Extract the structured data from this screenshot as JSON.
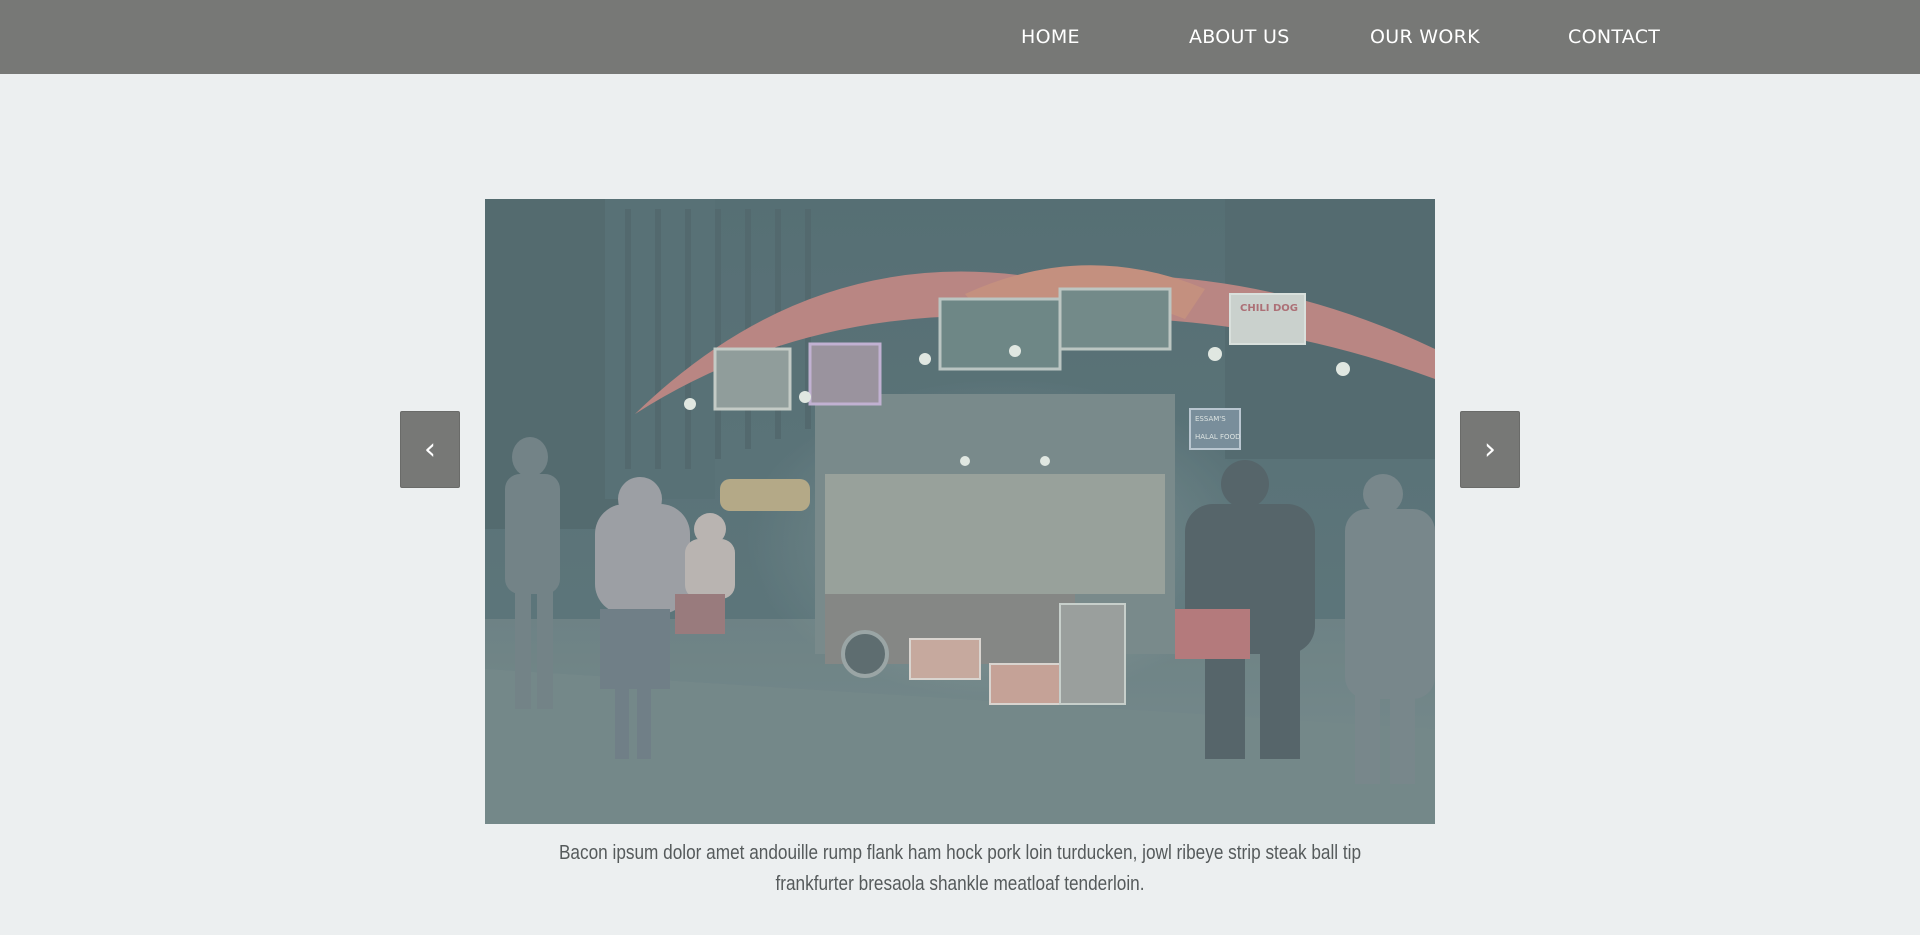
{
  "nav": {
    "items": [
      {
        "label": "HOME"
      },
      {
        "label": "ABOUT US"
      },
      {
        "label": "OUR WORK"
      },
      {
        "label": "CONTACT"
      }
    ]
  },
  "slider": {
    "prev_glyph": "‹",
    "next_glyph": "›",
    "image": {
      "alt": "",
      "signs": {
        "chili": "CHILI DOG",
        "halal": "HALAL FOOD",
        "essam": "ESSAM'S"
      }
    },
    "caption": "Bacon ipsum dolor amet andouille rump flank ham hock pork loin turducken, jowl ribeye strip steak ball tip frankfurter bresaola shankle meatloaf tenderloin."
  },
  "colors": {
    "navbar": "#777876",
    "page_bg": "#eceff0",
    "arrow_bg": "#777876",
    "caption_text": "#555a5b"
  }
}
